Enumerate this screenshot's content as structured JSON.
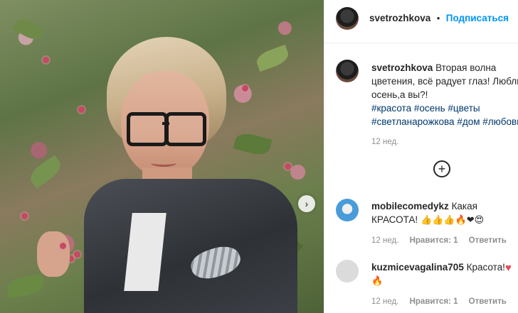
{
  "post": {
    "username": "svetrozhkova",
    "follow_label": "Подписаться",
    "caption_text_line1": "Вторая волна",
    "caption_text_line2": "цветения, всё радует глаз! Люблю",
    "caption_text_line3": "осень,а вы?!",
    "hashtags_line1": [
      "#красота",
      "#осень",
      "#цветы"
    ],
    "hashtags_line2": [
      "#светланарожкова",
      "#дом",
      "#любовь"
    ],
    "time": "12 нед."
  },
  "comments": [
    {
      "username": "mobilecomedykz",
      "text_line1": "Какая",
      "text_line2": "КРАСОТА!",
      "emojis": "👍👍👍🔥❤😍",
      "time": "12 нед.",
      "likes": "Нравится: 1",
      "reply": "Ответить"
    },
    {
      "username": "kuzmicevagalina705",
      "text_line1": "Красота!",
      "emojis": "🔥",
      "time": "12 нед.",
      "likes": "Нравится: 1",
      "reply": "Ответить"
    }
  ],
  "icons": {
    "next": "chevron-right-icon",
    "more_comments": "plus-circle-icon",
    "heart": "heart-icon"
  },
  "colors": {
    "follow": "#0095f6",
    "hashtag": "#00376b",
    "meta": "#8e8e8e"
  }
}
